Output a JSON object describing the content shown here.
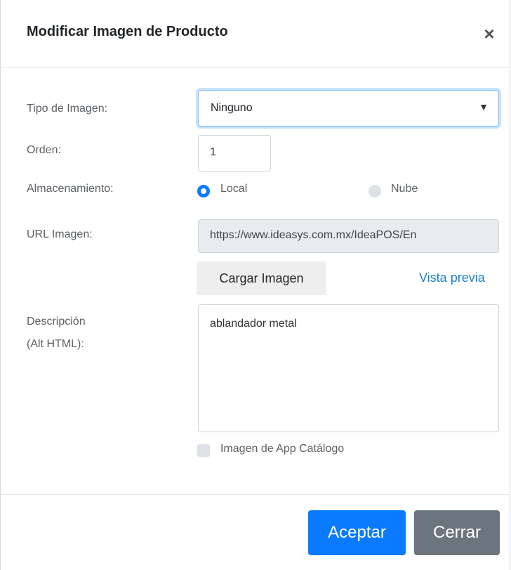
{
  "modal": {
    "title": "Modificar Imagen de Producto",
    "close_icon": "×"
  },
  "form": {
    "tipo_label": "Tipo de Imagen:",
    "tipo_value": "Ninguno",
    "tipo_arrow": "▼",
    "orden_label": "Orden:",
    "orden_value": "1",
    "almacenamiento_label": "Almacenamiento:",
    "option_local": "Local",
    "option_nube": "Nube",
    "selected_storage": "Local",
    "url_label": "URL Imagen:",
    "url_value": "https://www.ideasys.com.mx/IdeaPOS/En",
    "load_button": "Cargar Imagen",
    "preview_link": "Vista previa",
    "descripcion_label_line1": "Descripción",
    "descripcion_label_line2": "(Alt HTML):",
    "descripcion_value": "ablandador metal",
    "app_catalog_label": "Imagen de App Catálogo",
    "app_catalog_checked": false
  },
  "footer": {
    "accept_label": "Aceptar",
    "close_label": "Cerrar"
  },
  "colors": {
    "primary": "#0a7bff",
    "secondary": "#6c757d",
    "link": "#1a7fd0"
  }
}
